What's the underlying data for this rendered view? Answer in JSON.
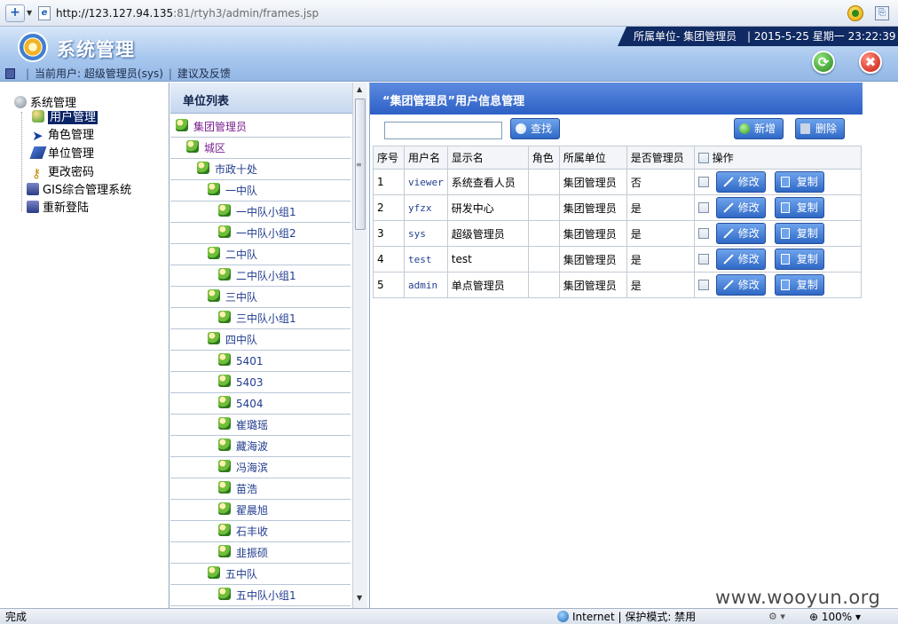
{
  "browser": {
    "url_host": "http://123.127.94.135",
    "url_path": ":81/rtyh3/admin/frames.jsp"
  },
  "header": {
    "title": "系统管理",
    "unit_label": "所属单位- 集团管理员",
    "date_label": "| 2015-5-25 星期一 23:22:39",
    "current_user": "当前用户: 超级管理员(sys)",
    "feedback": "建议及反馈",
    "separator": "|"
  },
  "nav": {
    "root": "系统管理",
    "items": [
      {
        "label": "用户管理",
        "icon": "users-icon",
        "active": true
      },
      {
        "label": "角色管理",
        "icon": "role-arrow-icon"
      },
      {
        "label": "单位管理",
        "icon": "unit-icon"
      },
      {
        "label": "更改密码",
        "icon": "key-icon"
      },
      {
        "label": "GIS综合管理系统",
        "icon": "gis-icon"
      },
      {
        "label": "重新登陆",
        "icon": "relogin-icon"
      }
    ]
  },
  "units": {
    "heading": "单位列表",
    "items": [
      {
        "label": "集团管理员",
        "level": 0
      },
      {
        "label": "城区",
        "level": 1
      },
      {
        "label": "市政十处",
        "level": 2
      },
      {
        "label": "一中队",
        "level": 3
      },
      {
        "label": "一中队小组1",
        "level": 4
      },
      {
        "label": "一中队小组2",
        "level": 4
      },
      {
        "label": "二中队",
        "level": 3
      },
      {
        "label": "二中队小组1",
        "level": 4
      },
      {
        "label": "三中队",
        "level": 3
      },
      {
        "label": "三中队小组1",
        "level": 4
      },
      {
        "label": "四中队",
        "level": 3
      },
      {
        "label": "5401",
        "level": 4
      },
      {
        "label": "5403",
        "level": 4
      },
      {
        "label": "5404",
        "level": 4
      },
      {
        "label": "崔璐瑶",
        "level": 4
      },
      {
        "label": "藏海波",
        "level": 4
      },
      {
        "label": "冯海滨",
        "level": 4
      },
      {
        "label": "苗浩",
        "level": 4
      },
      {
        "label": "翟晨旭",
        "level": 4
      },
      {
        "label": "石丰收",
        "level": 4
      },
      {
        "label": "韭振硕",
        "level": 4
      },
      {
        "label": "五中队",
        "level": 3
      },
      {
        "label": "五中队小组1",
        "level": 4
      }
    ]
  },
  "main": {
    "heading": "“集团管理员”用户信息管理",
    "search_value": "",
    "search_btn": "查找",
    "add_btn": "新增",
    "delete_btn": "删除",
    "columns": [
      "序号",
      "用户名",
      "显示名",
      "角色",
      "所属单位",
      "是否管理员",
      "操作"
    ],
    "edit_label": "修改",
    "copy_label": "复制",
    "rows": [
      {
        "no": "1",
        "username": "viewer",
        "display": "系统查看人员",
        "role": "",
        "unit": "集团管理员",
        "admin": "否"
      },
      {
        "no": "2",
        "username": "yfzx",
        "display": "研发中心",
        "role": "",
        "unit": "集团管理员",
        "admin": "是"
      },
      {
        "no": "3",
        "username": "sys",
        "display": "超级管理员",
        "role": "",
        "unit": "集团管理员",
        "admin": "是"
      },
      {
        "no": "4",
        "username": "test",
        "display": "test",
        "role": "",
        "unit": "集团管理员",
        "admin": "是"
      },
      {
        "no": "5",
        "username": "admin",
        "display": "单点管理员",
        "role": "",
        "unit": "集团管理员",
        "admin": "是"
      }
    ]
  },
  "statusbar": {
    "done": "完成",
    "zone": "Internet | 保护模式: 禁用",
    "zoom": "100%"
  },
  "watermark": "www.wooyun.org"
}
